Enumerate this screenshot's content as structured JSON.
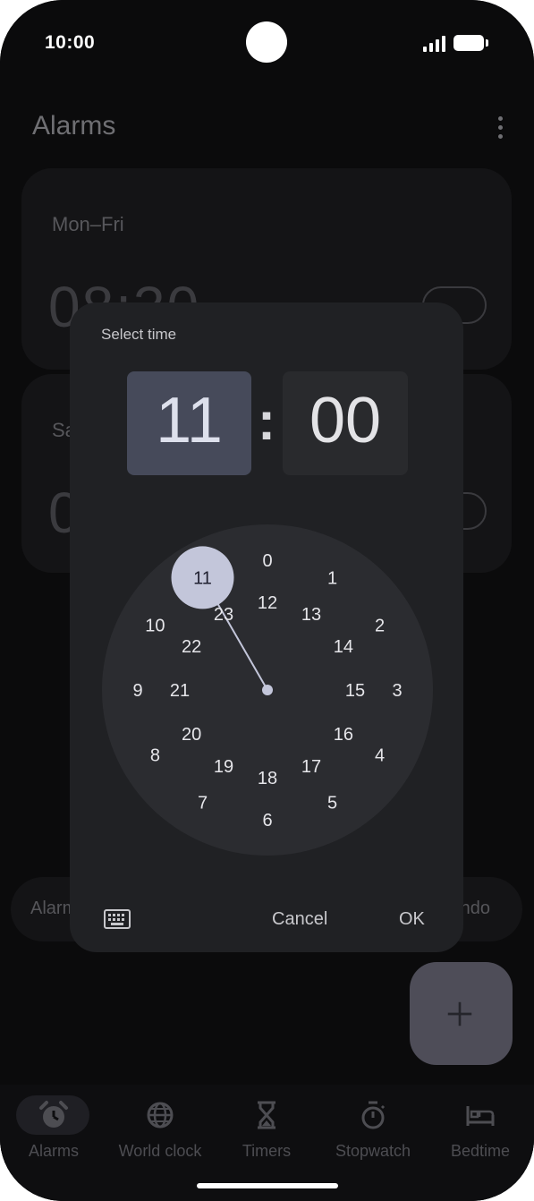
{
  "status_bar": {
    "time": "10:00"
  },
  "app": {
    "title": "Alarms",
    "alarms": [
      {
        "days": "Mon–Fri",
        "time": "08:30"
      },
      {
        "days": "Sa",
        "time": "0"
      }
    ],
    "chip_left": "Alarm",
    "chip_right": "ndo"
  },
  "nav": {
    "items": [
      {
        "label": "Alarms",
        "icon": "alarm-clock-icon",
        "active": true
      },
      {
        "label": "World clock",
        "icon": "globe-icon",
        "active": false
      },
      {
        "label": "Timers",
        "icon": "hourglass-icon",
        "active": false
      },
      {
        "label": "Stopwatch",
        "icon": "stopwatch-icon",
        "active": false
      },
      {
        "label": "Bedtime",
        "icon": "bed-icon",
        "active": false
      }
    ]
  },
  "fab": {
    "icon": "plus-icon"
  },
  "dialog": {
    "title": "Select time",
    "hour": "11",
    "separator": ":",
    "minute": "00",
    "selected_hour": 11,
    "outer_ring": [
      "0",
      "1",
      "2",
      "3",
      "4",
      "5",
      "6",
      "7",
      "8",
      "9",
      "10",
      "11"
    ],
    "inner_ring": [
      "12",
      "13",
      "14",
      "15",
      "16",
      "17",
      "18",
      "19",
      "20",
      "21",
      "22",
      "23"
    ],
    "keyboard_icon": "keyboard-icon",
    "cancel_label": "Cancel",
    "ok_label": "OK",
    "colors": {
      "selector": "#c3c6da",
      "dial_bg": "#2b2c30",
      "hour_box": "#464a5a"
    }
  }
}
